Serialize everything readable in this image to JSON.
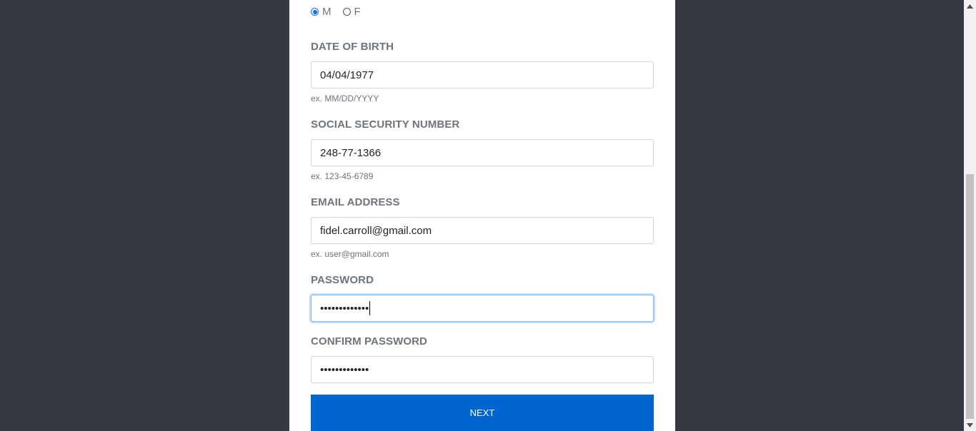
{
  "gender": {
    "options": [
      {
        "label": "M",
        "checked": true
      },
      {
        "label": "F",
        "checked": false
      }
    ]
  },
  "fields": {
    "dob": {
      "label": "DATE OF BIRTH",
      "value": "04/04/1977",
      "hint": "ex. MM/DD/YYYY"
    },
    "ssn": {
      "label": "SOCIAL SECURITY NUMBER",
      "value": "248-77-1366",
      "hint": "ex. 123-45-6789"
    },
    "email": {
      "label": "EMAIL ADDRESS",
      "value": "fidel.carroll@gmail.com",
      "hint": "ex. user@gmail.com"
    },
    "password": {
      "label": "PASSWORD",
      "value": "•••••••••••••"
    },
    "confirm_password": {
      "label": "CONFIRM PASSWORD",
      "value": "•••••••••••••"
    }
  },
  "actions": {
    "next_label": "NEXT"
  },
  "colors": {
    "page_background": "#343a40",
    "primary_button": "#0065d1",
    "focus_border": "#86b7fe"
  }
}
